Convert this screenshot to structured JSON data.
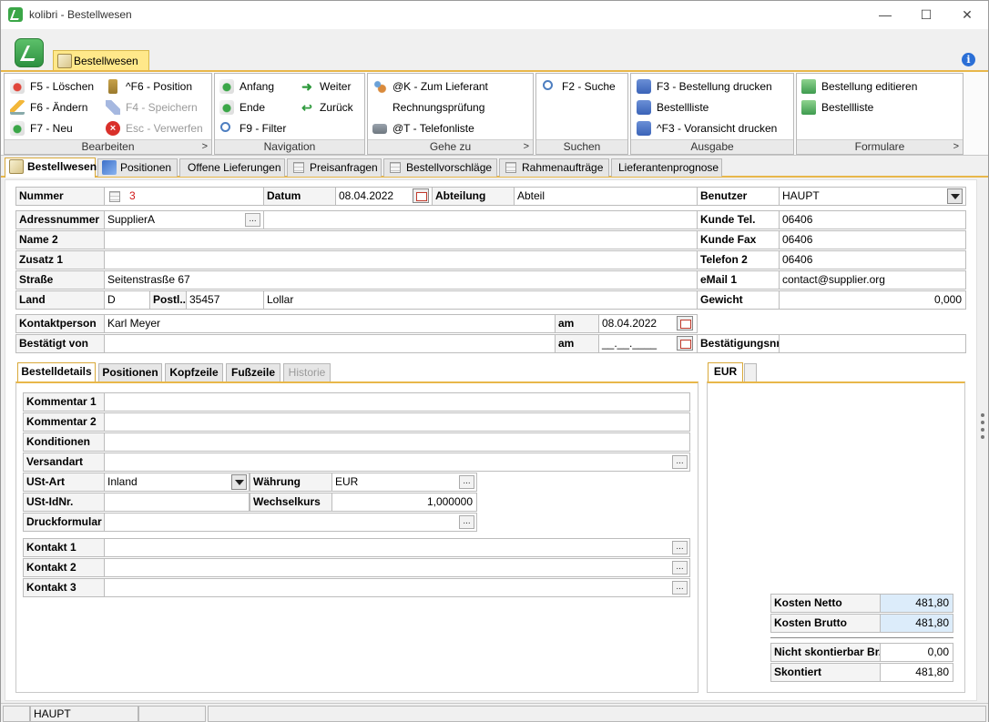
{
  "window": {
    "title": "kolibri - Bestellwesen"
  },
  "ribbon": {
    "tab": "Bestellwesen",
    "groups": {
      "bearbeiten": {
        "caption": "Bearbeiten",
        "items": [
          "F5 - Löschen",
          "F6 - Ändern",
          "F7 - Neu",
          "^F6 - Position",
          "F4 - Speichern",
          "Esc - Verwerfen"
        ]
      },
      "navigation": {
        "caption": "Navigation",
        "items": [
          "Anfang",
          "Ende",
          "F9 - Filter",
          "Weiter",
          "Zurück"
        ]
      },
      "gehezu": {
        "caption": "Gehe zu",
        "items": [
          "@K - Zum Lieferant",
          "Rechnungsprüfung",
          "@T - Telefonliste"
        ]
      },
      "suchen": {
        "caption": "Suchen",
        "items": [
          "F2 - Suche"
        ]
      },
      "ausgabe": {
        "caption": "Ausgabe",
        "items": [
          "F3 - Bestellung drucken",
          "Bestellliste",
          "^F3 - Voransicht drucken"
        ]
      },
      "formulare": {
        "caption": "Formulare",
        "items": [
          "Bestellung editieren",
          "Bestellliste"
        ]
      }
    }
  },
  "main_tabs": [
    "Bestellwesen",
    "Positionen",
    "Offene Lieferungen",
    "Preisanfragen",
    "Bestellvorschläge",
    "Rahmenaufträge",
    "Lieferantenprognose"
  ],
  "header": {
    "nummer_label": "Nummer",
    "nummer": "3",
    "datum_label": "Datum",
    "datum": "08.04.2022",
    "abteilung_label": "Abteilung",
    "abteilung": "Abteil",
    "benutzer_label": "Benutzer",
    "benutzer": "HAUPT",
    "adressnummer_label": "Adressnummer",
    "adressnummer": "SupplierA",
    "name2_label": "Name 2",
    "name2": "",
    "zusatz1_label": "Zusatz 1",
    "zusatz1": "",
    "strasse_label": "Straße",
    "strasse": "Seitenstrasße 67",
    "land_label": "Land",
    "land": "D",
    "postl_label": "Postl...",
    "plz": "35457",
    "ort": "Lollar",
    "kundetel_label": "Kunde Tel.",
    "kundetel": "06406",
    "kundefax_label": "Kunde Fax",
    "kundefax": "06406",
    "telefon2_label": "Telefon 2",
    "telefon2": "06406",
    "email1_label": "eMail 1",
    "email1": "contact@supplier.org",
    "gewicht_label": "Gewicht",
    "gewicht": "0,000",
    "kontaktperson_label": "Kontaktperson",
    "kontaktperson": "Karl Meyer",
    "am_label": "am",
    "am1": "08.04.2022",
    "bestaetigtvon_label": "Bestätigt von",
    "bestaetigtvon": "",
    "am2": "__.__.____",
    "bestaetigungsnr_label": "Bestätigungsnr.",
    "bestaetigungsnr": ""
  },
  "detail_tabs": [
    "Bestelldetails",
    "Positionen",
    "Kopfzeile",
    "Fußzeile",
    "Historie"
  ],
  "details": {
    "kommentar1_label": "Kommentar 1",
    "kommentar2_label": "Kommentar 2",
    "konditionen_label": "Konditionen",
    "versandart_label": "Versandart",
    "ustart_label": "USt-Art",
    "ustart": "Inland",
    "waehrung_label": "Währung",
    "waehrung": "EUR",
    "ustidnr_label": "USt-IdNr.",
    "wechselkurs_label": "Wechselkurs",
    "wechselkurs": "1,000000",
    "druckformular_label": "Druckformular",
    "kontakt1_label": "Kontakt 1",
    "kontakt2_label": "Kontakt 2",
    "kontakt3_label": "Kontakt 3"
  },
  "currency_tab": "EUR",
  "totals": {
    "kosten_netto_label": "Kosten Netto",
    "kosten_netto": "481,80",
    "kosten_brutto_label": "Kosten Brutto",
    "kosten_brutto": "481,80",
    "nicht_skonto_label": "Nicht skontierbar Br...",
    "nicht_skonto": "0,00",
    "skontiert_label": "Skontiert",
    "skontiert": "481,80"
  },
  "statusbar": {
    "user": "HAUPT"
  }
}
